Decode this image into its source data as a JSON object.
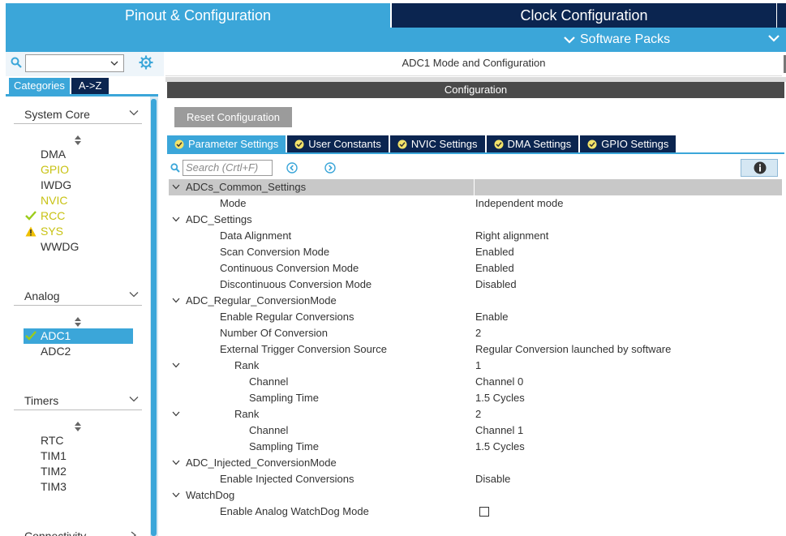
{
  "top_tabs": {
    "pinout": "Pinout & Configuration",
    "clock": "Clock Configuration"
  },
  "software_packs": "Software Packs",
  "left": {
    "search_value": "",
    "category_tabs": [
      "Categories",
      "A->Z"
    ],
    "sections": [
      {
        "title": "System Core",
        "items": [
          {
            "name": "DMA",
            "state": "normal"
          },
          {
            "name": "GPIO",
            "state": "configured"
          },
          {
            "name": "IWDG",
            "state": "normal"
          },
          {
            "name": "NVIC",
            "state": "configured"
          },
          {
            "name": "RCC",
            "state": "check"
          },
          {
            "name": "SYS",
            "state": "warning"
          },
          {
            "name": "WWDG",
            "state": "normal"
          }
        ]
      },
      {
        "title": "Analog",
        "items": [
          {
            "name": "ADC1",
            "state": "selected"
          },
          {
            "name": "ADC2",
            "state": "normal"
          }
        ]
      },
      {
        "title": "Timers",
        "items": [
          {
            "name": "RTC",
            "state": "normal"
          },
          {
            "name": "TIM1",
            "state": "normal"
          },
          {
            "name": "TIM2",
            "state": "normal"
          },
          {
            "name": "TIM3",
            "state": "normal"
          }
        ]
      },
      {
        "title": "Connectivity",
        "items": []
      }
    ]
  },
  "right": {
    "mode_title": "ADC1 Mode and Configuration",
    "config_title": "Configuration",
    "reset_label": "Reset Configuration",
    "tabs": [
      "Parameter Settings",
      "User Constants",
      "NVIC Settings",
      "DMA Settings",
      "GPIO Settings"
    ],
    "search_placeholder": "Search (Crtl+F)",
    "rows": [
      {
        "key": "ADCs_Common_Settings",
        "value": "",
        "group": true
      },
      {
        "key": "Mode",
        "value": "Independent mode"
      },
      {
        "key": "ADC_Settings",
        "value": "",
        "group": true
      },
      {
        "key": "Data Alignment",
        "value": "Right alignment"
      },
      {
        "key": "Scan Conversion Mode",
        "value": "Enabled"
      },
      {
        "key": "Continuous Conversion Mode",
        "value": "Enabled"
      },
      {
        "key": "Discontinuous Conversion Mode",
        "value": "Disabled"
      },
      {
        "key": "ADC_Regular_ConversionMode",
        "value": "",
        "group": true
      },
      {
        "key": "Enable Regular Conversions",
        "value": "Enable"
      },
      {
        "key": "Number Of Conversion",
        "value": "2"
      },
      {
        "key": "External Trigger Conversion Source",
        "value": "Regular Conversion launched by software"
      },
      {
        "key": "Rank",
        "value": "1",
        "subgroup": true
      },
      {
        "key": "Channel",
        "value": "Channel 0"
      },
      {
        "key": "Sampling Time",
        "value": "1.5 Cycles"
      },
      {
        "key": "Rank",
        "value": "2",
        "subgroup": true
      },
      {
        "key": "Channel",
        "value": "Channel 1"
      },
      {
        "key": "Sampling Time",
        "value": "1.5 Cycles"
      },
      {
        "key": "ADC_Injected_ConversionMode",
        "value": "",
        "group": true
      },
      {
        "key": "Enable Injected Conversions",
        "value": "Disable"
      },
      {
        "key": "WatchDog",
        "value": "",
        "group": true
      },
      {
        "key": "Enable Analog WatchDog Mode",
        "value": "",
        "checkbox": false
      }
    ]
  },
  "colors": {
    "accent": "#3ba6d9",
    "navy": "#0b2550",
    "configured": "#c8c213",
    "check": "#9ccc1a",
    "warning": "#f0c000"
  }
}
